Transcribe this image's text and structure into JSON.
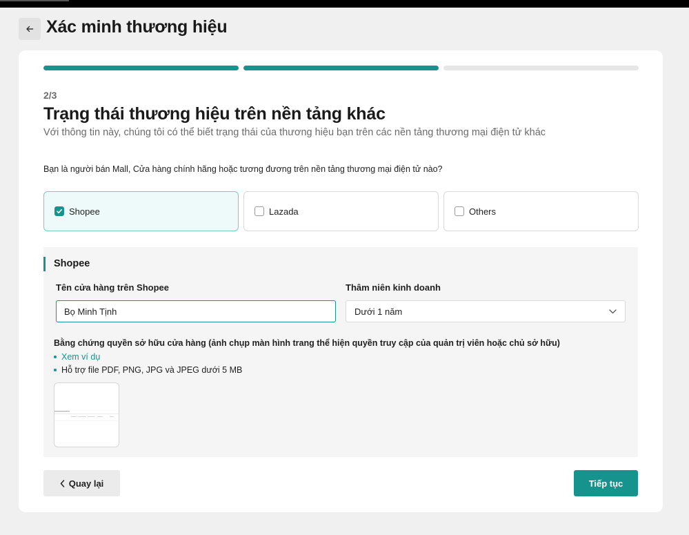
{
  "header": {
    "title": "Xác minh thương hiệu",
    "back_icon": "arrow-left-icon"
  },
  "progress": {
    "current_step": 2,
    "total_steps": 3,
    "label": "2/3"
  },
  "section": {
    "title": "Trạng thái thương hiệu trên nền tảng khác",
    "subtitle": "Với thông tin này, chúng tôi có thể biết trạng thái của thương hiệu bạn trên các nền tảng thương mại điện tử khác"
  },
  "question": "Bạn là người bán Mall, Cửa hàng chính hãng hoặc tương đương trên nền tảng thương mại điện tử nào?",
  "platforms": [
    {
      "label": "Shopee",
      "checked": true
    },
    {
      "label": "Lazada",
      "checked": false
    },
    {
      "label": "Others",
      "checked": false
    }
  ],
  "shopee_panel": {
    "title": "Shopee",
    "store_name_label": "Tên cửa hàng trên Shopee",
    "store_name_value": "Bọ Minh Tịnh",
    "seniority_label": "Thâm niên kinh doanh",
    "seniority_value": "Dưới 1 năm",
    "proof_label": "Bằng chứng quyền sở hữu cửa hàng (ảnh chụp màn hình trang thể hiện quyền truy cập của quản trị viên hoặc chủ sở hữu)",
    "example_link": "Xem ví dụ",
    "file_hint": "Hỗ trợ file PDF, PNG, JPG và JPEG dưới 5 MB"
  },
  "footer": {
    "back_label": "Quay lại",
    "next_label": "Tiếp tục"
  },
  "colors": {
    "accent": "#17938d",
    "selected_bg": "#eefaf9",
    "panel_bg": "#f5f5f5",
    "page_bg": "#f0f0f1"
  }
}
